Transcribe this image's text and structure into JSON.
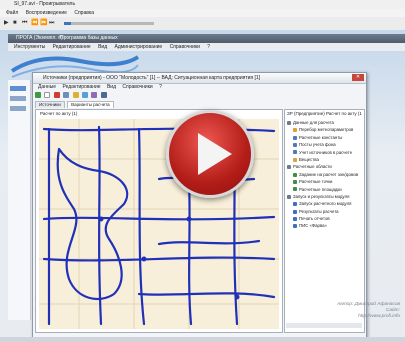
{
  "player": {
    "title": "SI_97.avi - Проигрыватель",
    "menu": [
      "Файл",
      "Воспроизведение",
      "Справка"
    ],
    "controls": [
      "play-icon",
      "stop-icon",
      "prev-icon",
      "rewind-icon",
      "forward-icon",
      "next-icon"
    ],
    "progress": 0.08
  },
  "app": {
    "title_left": "ПРОГА (Экземпл. #)",
    "title_mid": "Программа базы данных",
    "menu": [
      "Инструменты",
      "Редактирование",
      "Вид",
      "Администрирование",
      "Справочники",
      "?"
    ]
  },
  "dialog": {
    "title": "Источники (предприятия) - ООО \"Молодость\" [1] -- ВАД: Ситуационная карта предприятия [1]",
    "menu": [
      "Данные",
      "Редактирование",
      "Вид",
      "Справочники",
      "?"
    ],
    "tabs": [
      "Источники",
      "Варианты расчета"
    ],
    "active_tab": 1,
    "map_title": "Расчет по акту (1)",
    "right_header": "ЗР (Предприятие) Расчет по акту (1)",
    "tree": [
      {
        "label": "Данные для расчета",
        "icon": "folder-icon",
        "level": 0,
        "color": "#6d7b8d"
      },
      {
        "label": "Перебор метеопараметров",
        "icon": "weather-icon",
        "level": 1,
        "color": "#e0a030"
      },
      {
        "label": "Расчетные константы",
        "icon": "constants-icon",
        "level": 1,
        "color": "#4f79b8"
      },
      {
        "label": "Посты учета фона",
        "icon": "post-icon",
        "level": 1,
        "color": "#4f79b8"
      },
      {
        "label": "Учет источников в расчете",
        "icon": "sources-icon",
        "level": 1,
        "color": "#4f79b8"
      },
      {
        "label": "Вещества",
        "icon": "substance-icon",
        "level": 1,
        "color": "#d6a440"
      },
      {
        "label": "Расчетные области",
        "icon": "folder-icon",
        "level": 0,
        "color": "#6d7b8d"
      },
      {
        "label": "Задание на расчет зон/домов",
        "icon": "zone-icon",
        "level": 1,
        "color": "#3f8f4a"
      },
      {
        "label": "Расчетные точки",
        "icon": "points-icon",
        "level": 1,
        "color": "#3f8f4a"
      },
      {
        "label": "Расчетные площадки",
        "icon": "area-icon",
        "level": 1,
        "color": "#3f8f4a"
      },
      {
        "label": "Запуск и результаты модуля",
        "icon": "folder-icon",
        "level": 0,
        "color": "#6d7b8d"
      },
      {
        "label": "Запуск расчетного модуля",
        "icon": "run-icon",
        "level": 1,
        "color": "#3f6fc0"
      },
      {
        "label": "Результаты расчета",
        "icon": "results-icon",
        "level": 1,
        "color": "#3f6fc0"
      },
      {
        "label": "Печать отчетов",
        "icon": "print-icon",
        "level": 1,
        "color": "#3f6fc0"
      },
      {
        "label": "ПИС «Фарва»",
        "icon": "gis-icon",
        "level": 1,
        "color": "#3f6fc0"
      }
    ]
  },
  "watermark": {
    "line1": "Автор: Дмитрий Афанасов",
    "line2": "Сайт:",
    "line3": "http://www.profi.info"
  },
  "overlay": {
    "icon": "play-button-icon"
  }
}
